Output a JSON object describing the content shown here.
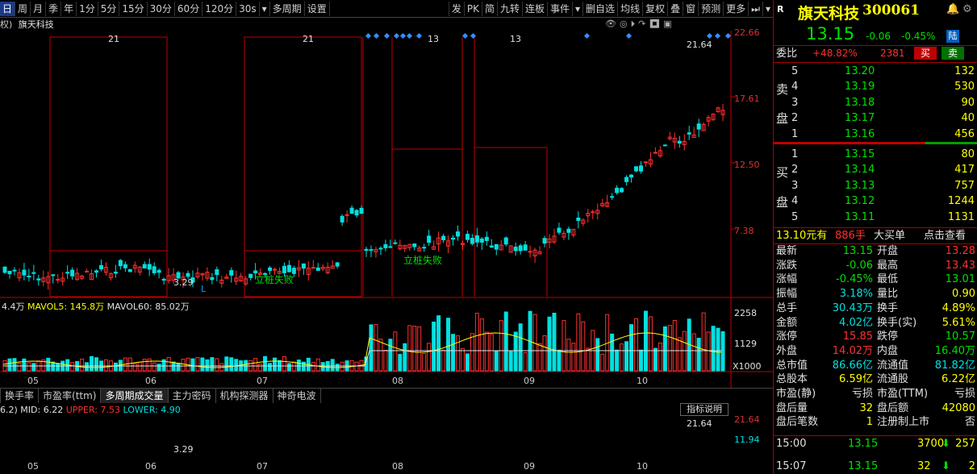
{
  "toolbar": {
    "periods": [
      "日",
      "周",
      "月",
      "季",
      "年",
      "1分",
      "5分",
      "15分",
      "30分",
      "60分",
      "120分",
      "30s",
      "多周期",
      "设置"
    ],
    "active_index": 0,
    "right": [
      "发",
      "PK",
      "简",
      "九转",
      "连板",
      "事件",
      "删自选",
      "均线",
      "复权",
      "叠",
      "窗",
      "预测",
      "更多"
    ]
  },
  "chart_header": {
    "left_fragment": "权)",
    "name": "旗天科技"
  },
  "price_axis": {
    "ticks": [
      "22.66",
      "17.61",
      "12.50",
      "7.38"
    ]
  },
  "day_labels": [
    "21",
    "21",
    "13",
    "13"
  ],
  "annotations": {
    "high": "21.64",
    "low": "3.29",
    "signal1": "立桩失败",
    "signal2": "立桩失败",
    "L": "L"
  },
  "volume_legend": {
    "a": "4.4万",
    "b": "MAVOL5: 145.8万",
    "c": "MAVOL60: 85.02万"
  },
  "volume_axis": {
    "ticks": [
      "2258",
      "1129",
      "X1000"
    ]
  },
  "months": [
    "05",
    "06",
    "07",
    "08",
    "09",
    "10"
  ],
  "tabs": [
    "换手率",
    "市盈率(ttm)",
    "多周期成交量",
    "主力密码",
    "机构探测器",
    "神奇电波"
  ],
  "active_tab": 2,
  "indicator_legend": {
    "a": "6.2)",
    "mid": "MID: 6.22",
    "upper": "UPPER: 7.53",
    "lower": "LOWER: 4.90"
  },
  "indicator_btn": "指标说明",
  "indicator_axis": {
    "ticks": [
      "21.64",
      "11.94"
    ],
    "high": "21.64",
    "low": "3.29"
  },
  "quote": {
    "r_badge": "R",
    "name": "旗天科技",
    "code": "300061",
    "price": "13.15",
    "change": "-0.06",
    "pct": "-0.45%",
    "board": "陆",
    "weibi_label": "委比",
    "weibi": "+48.82%",
    "weicha": "2381",
    "buy_btn": "买",
    "sell_btn": "卖",
    "sell_label": [
      "卖",
      "盘"
    ],
    "buy_label": [
      "买",
      "盘"
    ],
    "asks": [
      {
        "lv": "5",
        "p": "13.20",
        "v": "132"
      },
      {
        "lv": "4",
        "p": "13.19",
        "v": "530"
      },
      {
        "lv": "3",
        "p": "13.18",
        "v": "90"
      },
      {
        "lv": "2",
        "p": "13.17",
        "v": "40"
      },
      {
        "lv": "1",
        "p": "13.16",
        "v": "456"
      }
    ],
    "bids": [
      {
        "lv": "1",
        "p": "13.15",
        "v": "80"
      },
      {
        "lv": "2",
        "p": "13.14",
        "v": "417"
      },
      {
        "lv": "3",
        "p": "13.13",
        "v": "757"
      },
      {
        "lv": "4",
        "p": "13.12",
        "v": "1244"
      },
      {
        "lv": "5",
        "p": "13.11",
        "v": "1131"
      }
    ],
    "big": {
      "a": "13.10元有",
      "b": "886手",
      "c": "大买单",
      "d": "点击查看"
    },
    "stats": [
      {
        "k1": "最新",
        "v1": "13.15",
        "c1": "g",
        "k2": "开盘",
        "v2": "13.28",
        "c2": "r"
      },
      {
        "k1": "涨跌",
        "v1": "-0.06",
        "c1": "g",
        "k2": "最高",
        "v2": "13.43",
        "c2": "r"
      },
      {
        "k1": "涨幅",
        "v1": "-0.45%",
        "c1": "g",
        "k2": "最低",
        "v2": "13.01",
        "c2": "g"
      },
      {
        "k1": "振幅",
        "v1": "3.18%",
        "c1": "c",
        "k2": "量比",
        "v2": "0.90",
        "c2": "y"
      },
      {
        "k1": "总手",
        "v1": "30.43万",
        "c1": "c",
        "k2": "换手",
        "v2": "4.89%",
        "c2": "y"
      },
      {
        "k1": "金额",
        "v1": "4.02亿",
        "c1": "c",
        "k2": "换手(实)",
        "v2": "5.61%",
        "c2": "y"
      },
      {
        "k1": "涨停",
        "v1": "15.85",
        "c1": "r",
        "k2": "跌停",
        "v2": "10.57",
        "c2": "g"
      },
      {
        "k1": "外盘",
        "v1": "14.02万",
        "c1": "r",
        "k2": "内盘",
        "v2": "16.40万",
        "c2": "g"
      },
      {
        "k1": "总市值",
        "v1": "86.66亿",
        "c1": "c",
        "k2": "流通值",
        "v2": "81.82亿",
        "c2": "c"
      },
      {
        "k1": "总股本",
        "v1": "6.59亿",
        "c1": "y",
        "k2": "流通股",
        "v2": "6.22亿",
        "c2": "y"
      },
      {
        "k1": "市盈(静)",
        "v1": "亏损",
        "c1": "w",
        "k2": "市盈(TTM)",
        "v2": "亏损",
        "c2": "w"
      },
      {
        "k1": "盘后量",
        "v1": "32",
        "c1": "y",
        "k2": "盘后额",
        "v2": "42080",
        "c2": "y"
      },
      {
        "k1": "盘后笔数",
        "v1": "1",
        "c1": "y",
        "k2": "注册制上市",
        "v2": "否",
        "c2": "w"
      }
    ],
    "ticks": [
      {
        "t": "15:00",
        "p": "13.15",
        "v": "3700",
        "n": "257"
      },
      {
        "t": "15:07",
        "p": "13.15",
        "v": "32",
        "n": "2"
      }
    ]
  },
  "colors": {
    "up": "#ff3030",
    "down": "#00e0e0",
    "bg": "#000000",
    "grid": "#8a0000"
  }
}
